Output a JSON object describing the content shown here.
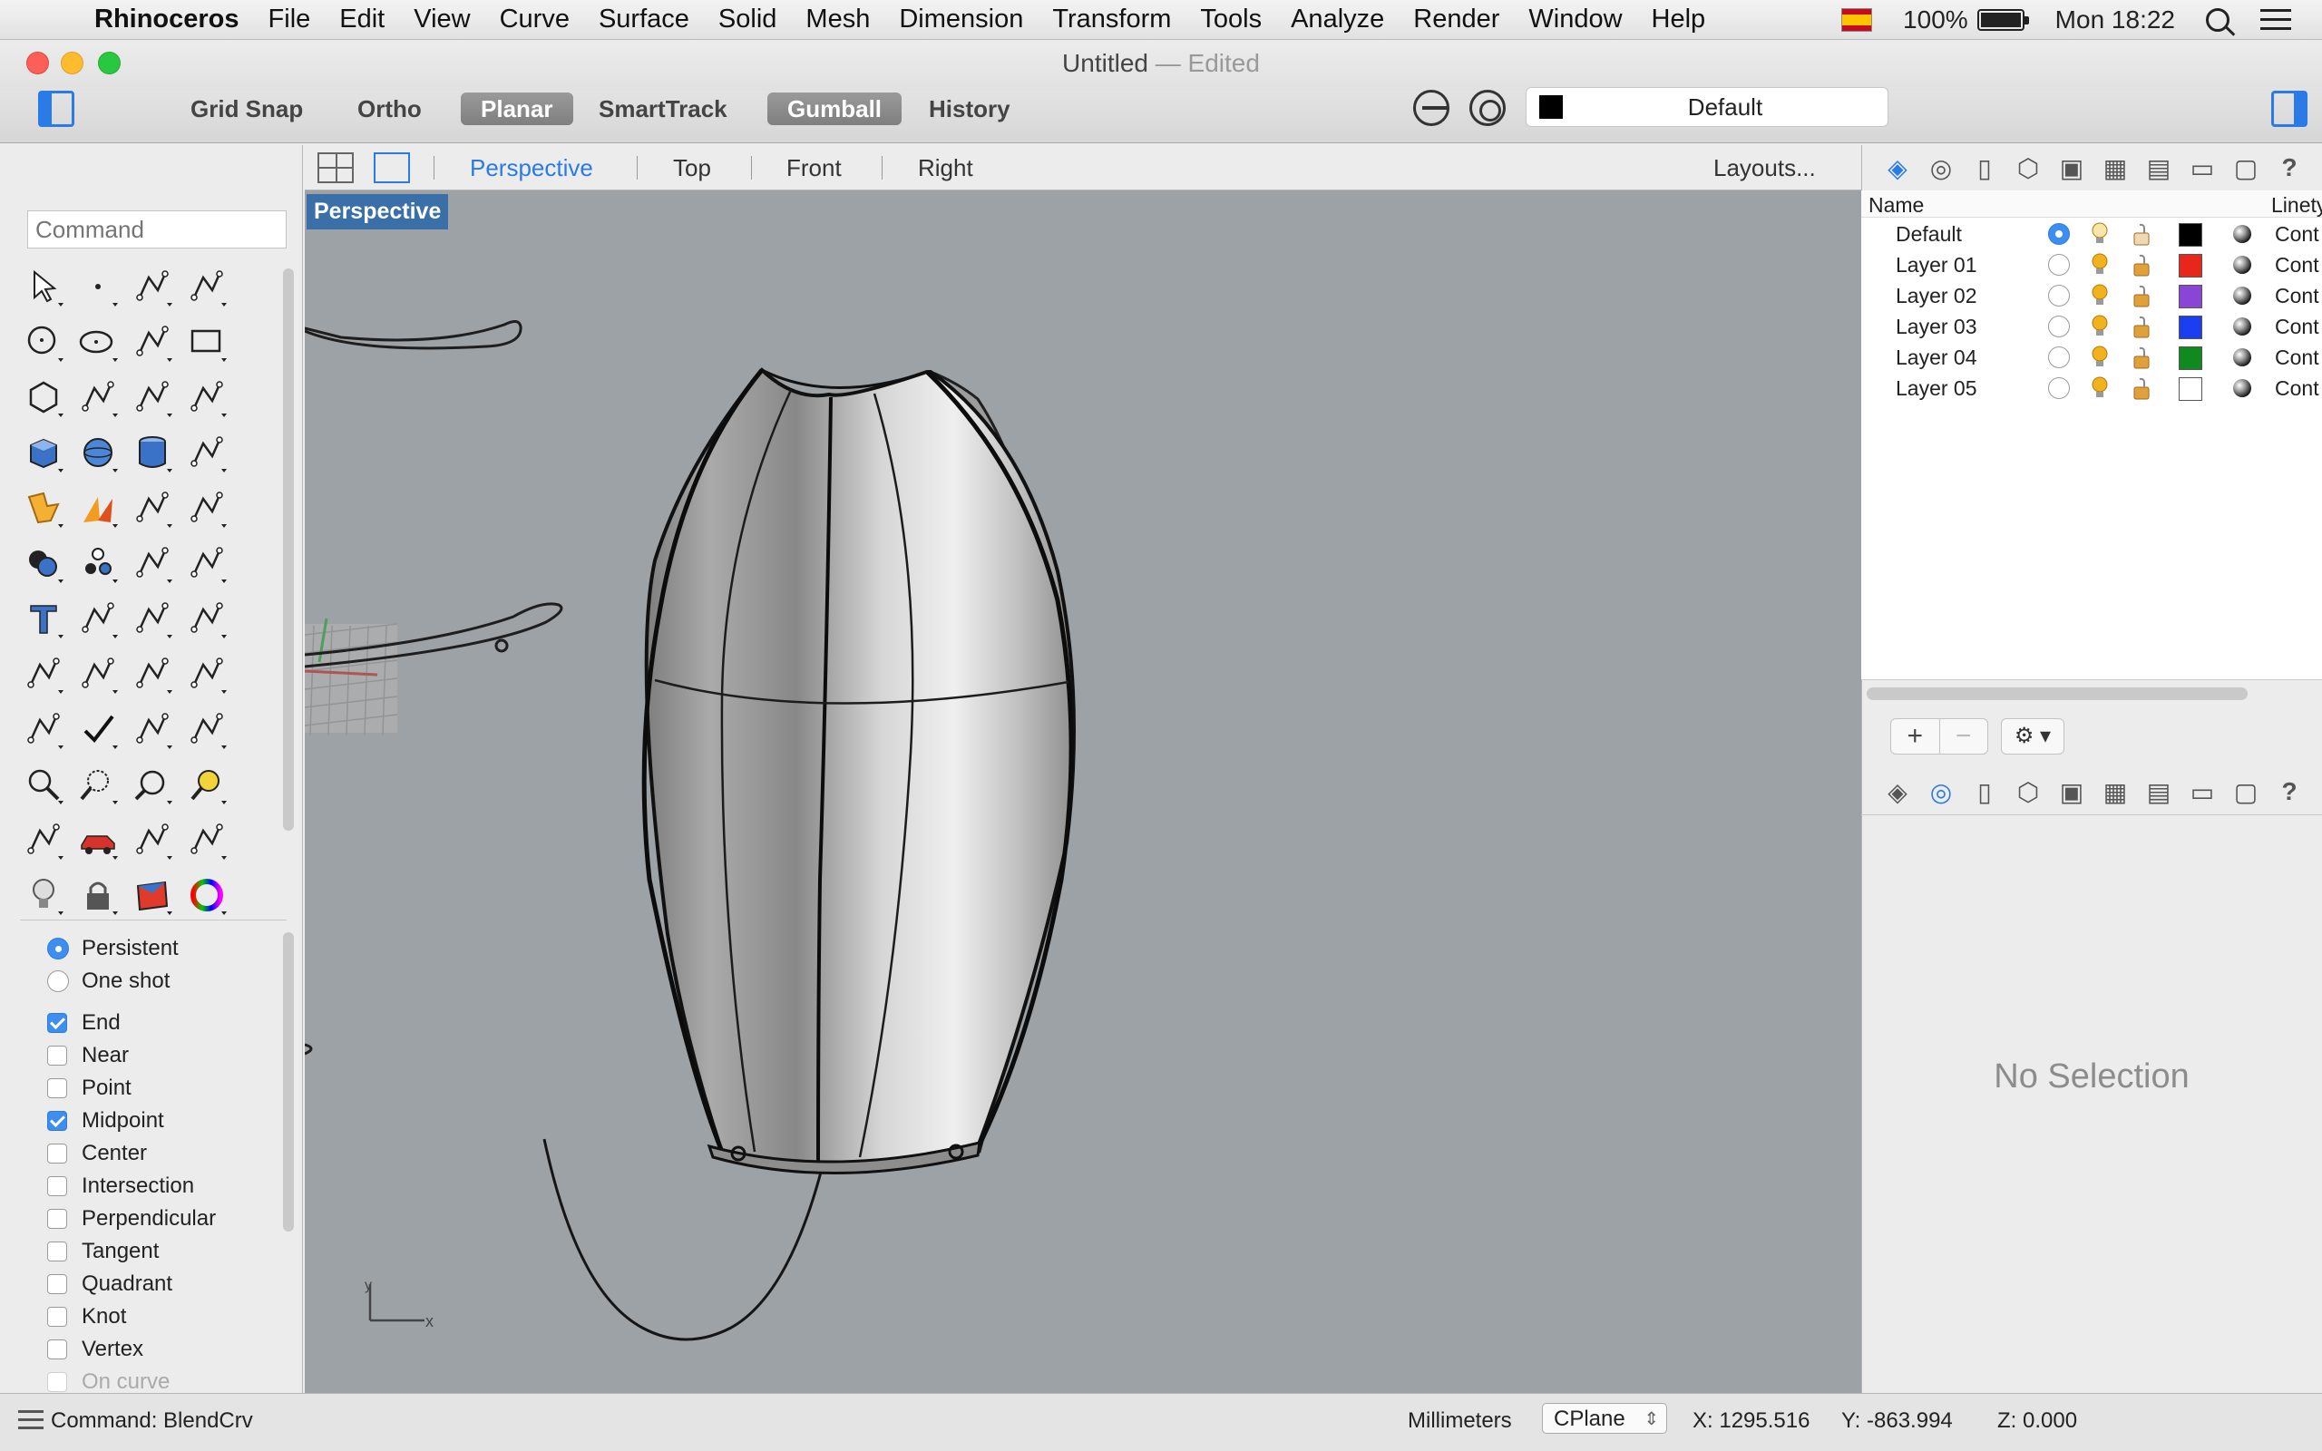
{
  "menubar": {
    "items": [
      "Rhinoceros",
      "File",
      "Edit",
      "View",
      "Curve",
      "Surface",
      "Solid",
      "Mesh",
      "Dimension",
      "Transform",
      "Tools",
      "Analyze",
      "Render",
      "Window",
      "Help"
    ],
    "battery": "100%",
    "clock": "Mon 18:22"
  },
  "window": {
    "title": "Untitled",
    "dash": "—",
    "status": "Edited"
  },
  "toolbar": {
    "snaps": [
      {
        "label": "Grid Snap",
        "on": false
      },
      {
        "label": "Ortho",
        "on": false
      },
      {
        "label": "Planar",
        "on": true
      },
      {
        "label": "SmartTrack",
        "on": false
      },
      {
        "label": "Gumball",
        "on": true
      },
      {
        "label": "History",
        "on": false
      }
    ],
    "layer": "Default"
  },
  "command": {
    "placeholder": "Command"
  },
  "osnap": {
    "modes": [
      {
        "label": "Persistent",
        "type": "radio",
        "on": true
      },
      {
        "label": "One shot",
        "type": "radio",
        "on": false
      }
    ],
    "snaps": [
      {
        "label": "End",
        "on": true
      },
      {
        "label": "Near",
        "on": false
      },
      {
        "label": "Point",
        "on": false
      },
      {
        "label": "Midpoint",
        "on": true
      },
      {
        "label": "Center",
        "on": false
      },
      {
        "label": "Intersection",
        "on": false
      },
      {
        "label": "Perpendicular",
        "on": false
      },
      {
        "label": "Tangent",
        "on": false
      },
      {
        "label": "Quadrant",
        "on": false
      },
      {
        "label": "Knot",
        "on": false
      },
      {
        "label": "Vertex",
        "on": false
      },
      {
        "label": "On curve",
        "on": false,
        "disabled": true
      }
    ]
  },
  "viewport_tabs": {
    "tabs": [
      "Perspective",
      "Top",
      "Front",
      "Right"
    ],
    "active": "Perspective",
    "layouts": "Layouts..."
  },
  "viewport": {
    "label": "Perspective",
    "axis_x": "x",
    "axis_y": "y"
  },
  "layers": {
    "headers": {
      "name": "Name",
      "linetype": "Linety"
    },
    "rows": [
      {
        "name": "Default",
        "current": true,
        "color": "#000000",
        "linetype": "Cont"
      },
      {
        "name": "Layer 01",
        "current": false,
        "color": "#e8261a",
        "linetype": "Cont"
      },
      {
        "name": "Layer 02",
        "current": false,
        "color": "#8a45d6",
        "linetype": "Cont"
      },
      {
        "name": "Layer 03",
        "current": false,
        "color": "#1a3ef0",
        "linetype": "Cont"
      },
      {
        "name": "Layer 04",
        "current": false,
        "color": "#0e8a1e",
        "linetype": "Cont"
      },
      {
        "name": "Layer 05",
        "current": false,
        "color": "#ffffff",
        "linetype": "Cont"
      }
    ],
    "add": "+",
    "remove": "−"
  },
  "properties": {
    "empty": "No Selection"
  },
  "status": {
    "command": "Command: BlendCrv",
    "units": "Millimeters",
    "cplane": "CPlane",
    "x": "X: 1295.516",
    "y": "Y: -863.994",
    "z": "Z: 0.000"
  },
  "colors": {
    "accent": "#2a7be5",
    "viewport_bg": "#9da2a6",
    "label_bg": "#3a6fa8"
  }
}
